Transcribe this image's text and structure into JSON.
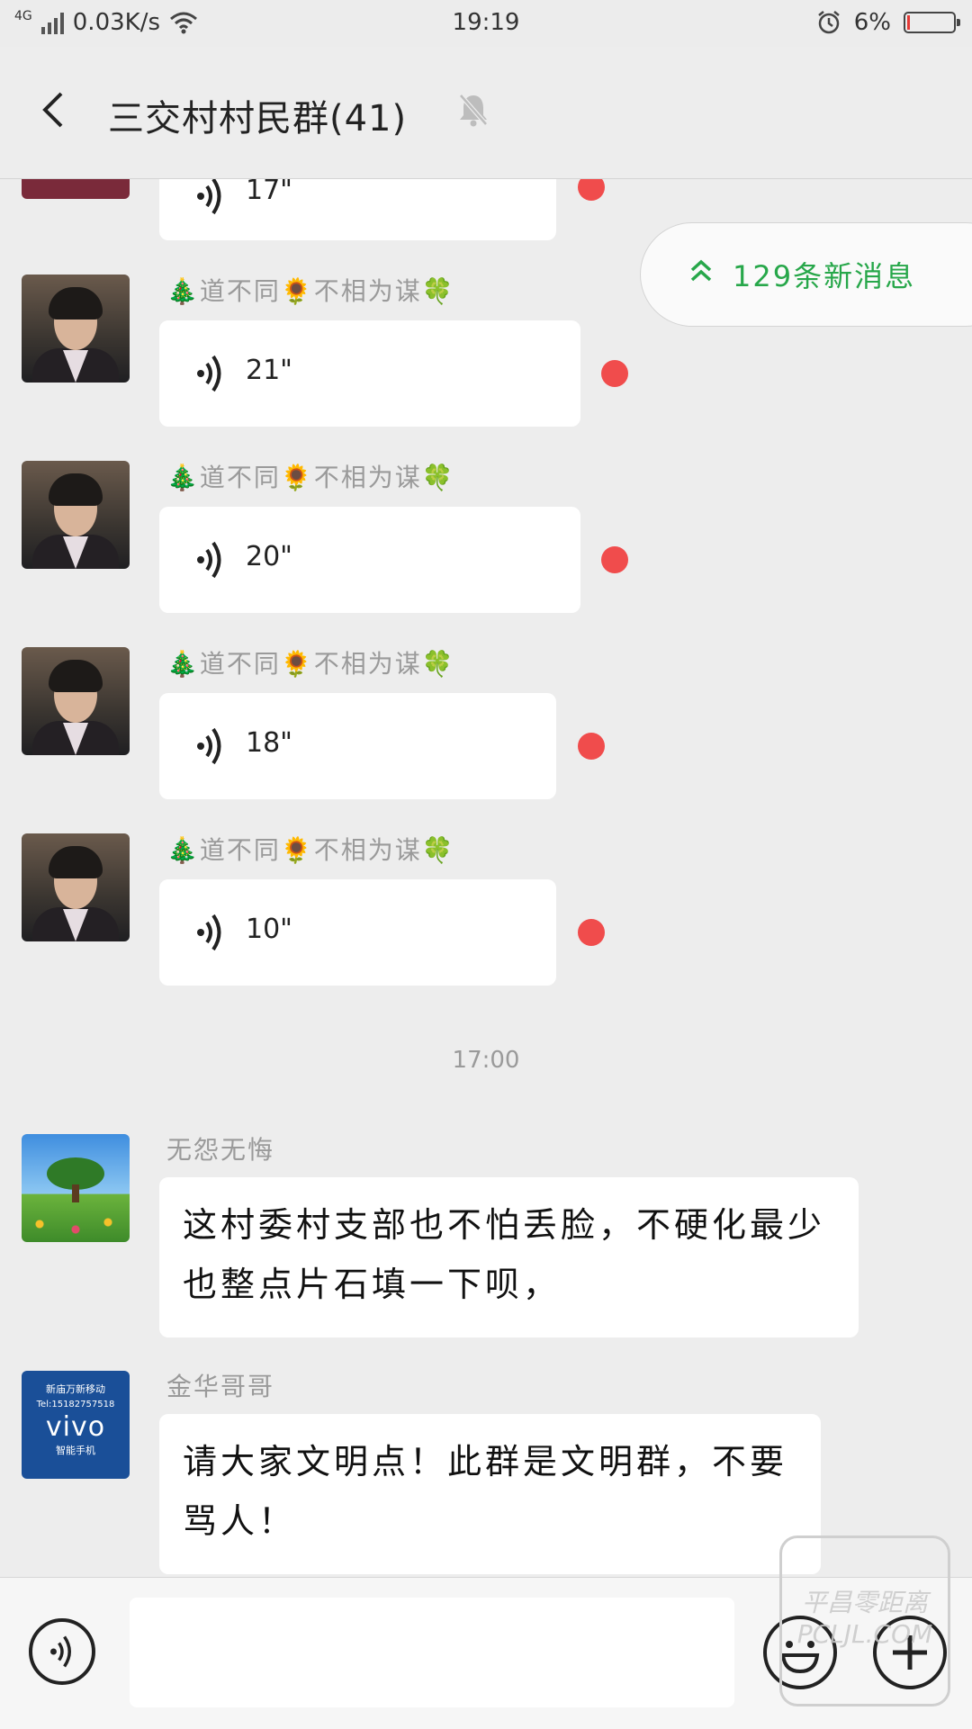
{
  "status_bar": {
    "network": "4G",
    "speed": "0.03K/s",
    "time": "19:19",
    "battery": "6%",
    "battery_level": 0.06
  },
  "header": {
    "title": "三交村村民群(41)",
    "back_icon": "chevron-left",
    "mute_icon": "bell-off"
  },
  "new_messages": {
    "label": "129条新消息",
    "icon": "double-chevron-up",
    "color": "#27a74a"
  },
  "messages": [
    {
      "type": "voice",
      "duration": "17\"",
      "unread": true
    },
    {
      "type": "voice",
      "sender": "🎄道不同🌻不相为谋🍀",
      "duration": "21\"",
      "unread": true
    },
    {
      "type": "voice",
      "sender": "🎄道不同🌻不相为谋🍀",
      "duration": "20\"",
      "unread": true
    },
    {
      "type": "voice",
      "sender": "🎄道不同🌻不相为谋🍀",
      "duration": "18\"",
      "unread": true
    },
    {
      "type": "voice",
      "sender": "🎄道不同🌻不相为谋🍀",
      "duration": "10\"",
      "unread": true
    },
    {
      "type": "time",
      "text": "17:00"
    },
    {
      "type": "text",
      "sender": "无怨无悔",
      "text": "这村委村支部也不怕丢脸，不硬化最少也整点片石填一下呗，"
    },
    {
      "type": "text",
      "sender": "金华哥哥",
      "text": "请大家文明点！此群是文明群，不要骂人！"
    }
  ],
  "avatars": {
    "vivo": {
      "line1": "新庙万新移动",
      "line2": "Tel:15182757518",
      "brand": "vivo",
      "line4": "智能手机"
    }
  },
  "watermark": "平昌零距离 PCLJL.COM"
}
